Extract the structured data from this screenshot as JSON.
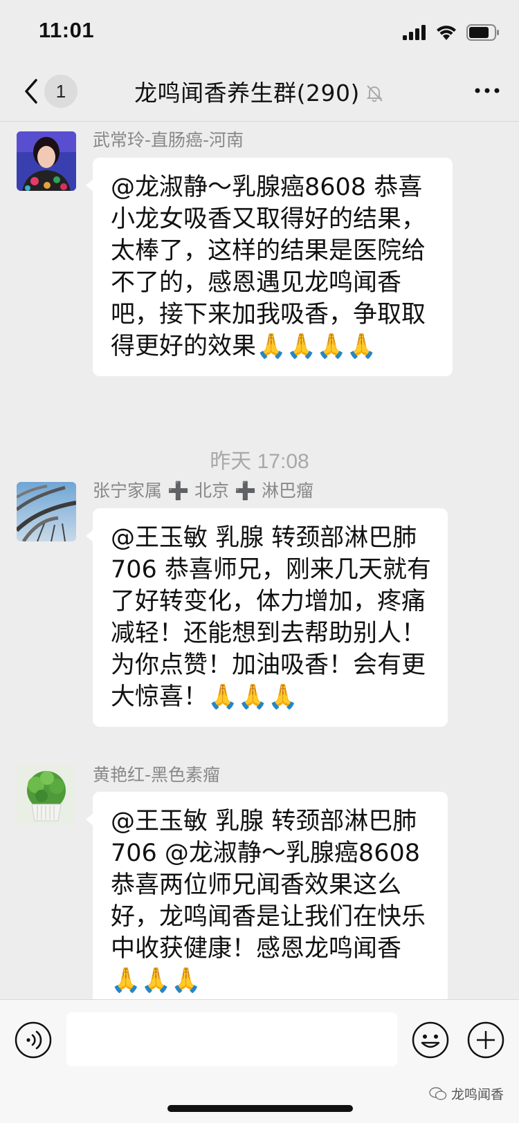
{
  "status": {
    "time": "11:01"
  },
  "header": {
    "back_count": "1",
    "title": "龙鸣闻香养生群(290)"
  },
  "messages": [
    {
      "sender": "武常玲-直肠癌-河南",
      "text": "@龙淑静～乳腺癌8608 恭喜小龙女吸香又取得好的结果，太棒了，这样的结果是医院给不了的，感恩遇见龙鸣闻香吧，接下来加我吸香，争取取得更好的效果🙏🙏🙏🙏"
    },
    {
      "sender": "张宁家属 ➕ 北京 ➕ 淋巴瘤",
      "text": "@王玉敏 乳腺 转颈部淋巴肺706 恭喜师兄，刚来几天就有了好转变化，体力增加，疼痛减轻！还能想到去帮助别人！为你点赞！加油吸香！会有更大惊喜！🙏🙏🙏"
    },
    {
      "sender": "黄艳红-黑色素瘤",
      "text": "@王玉敏 乳腺 转颈部淋巴肺706 @龙淑静～乳腺癌8608 恭喜两位师兄闻香效果这么好，龙鸣闻香是让我们在快乐中收获健康！感恩龙鸣闻香🙏🙏🙏"
    }
  ],
  "time_separator": "昨天 17:08",
  "input": {
    "placeholder": ""
  },
  "watermark": "龙鸣闻香"
}
